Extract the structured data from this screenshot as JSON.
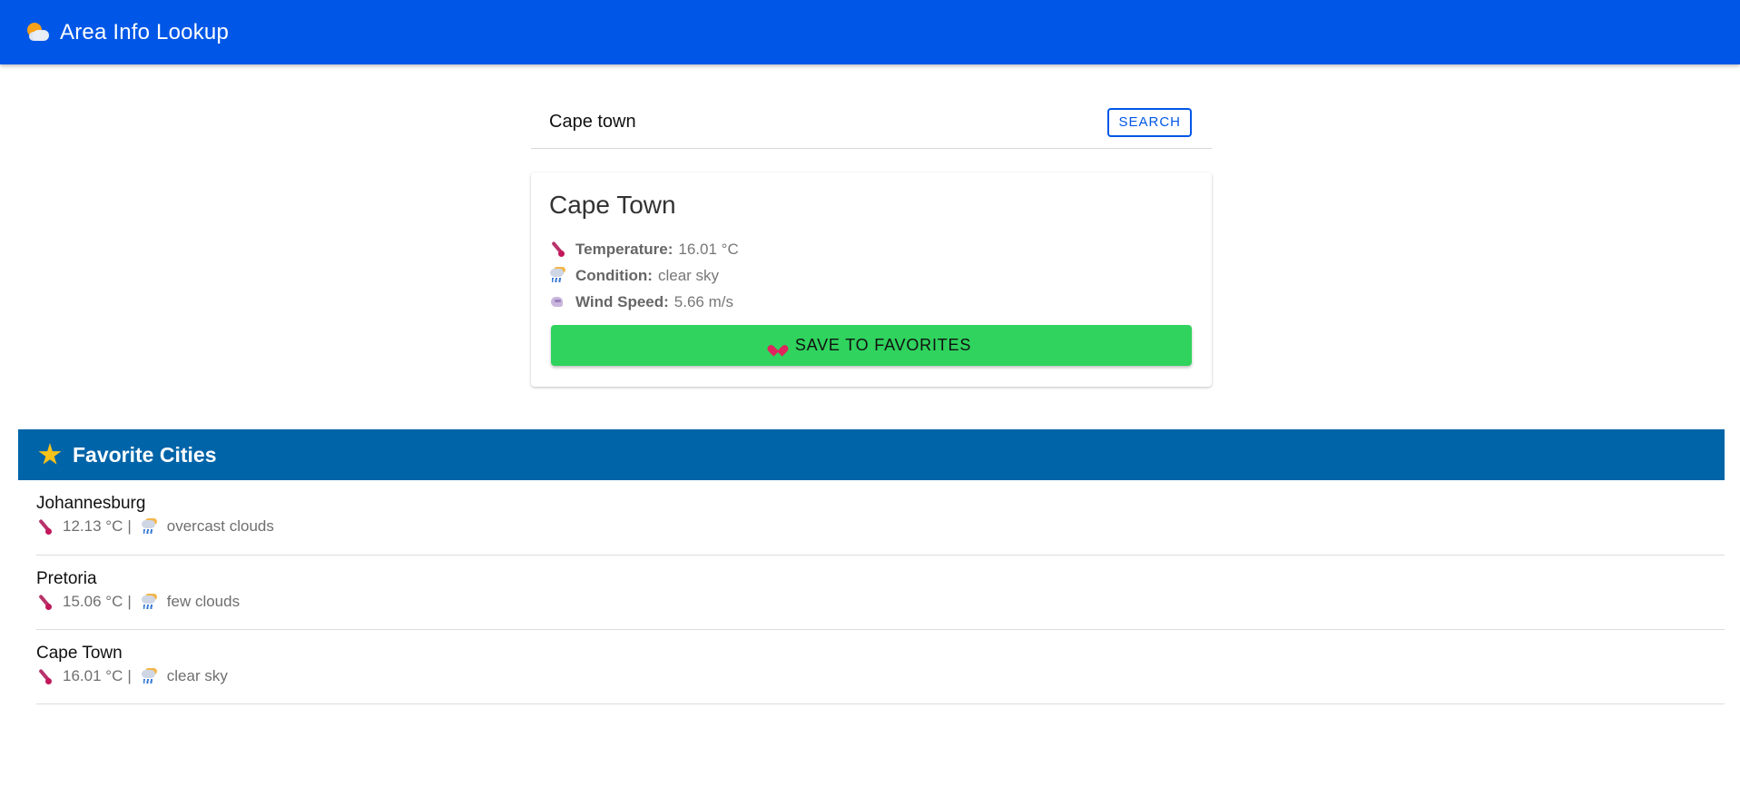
{
  "app": {
    "title": "Area Info Lookup",
    "logo_icon": "sun-behind-cloud-icon",
    "brand_color": "#0057e7"
  },
  "search": {
    "value": "Cape town",
    "placeholder": "",
    "button_label": "SEARCH"
  },
  "result": {
    "city": "Cape Town",
    "temperature_label": "Temperature:",
    "temperature_value": "16.01 °C",
    "condition_label": "Condition:",
    "condition_value": "clear sky",
    "wind_label": "Wind Speed:",
    "wind_value": "5.66 m/s",
    "save_button_label": "SAVE TO FAVORITES",
    "save_button_color": "#2fd35d"
  },
  "favorites": {
    "title": "Favorite Cities",
    "header_color": "#0064a8",
    "separator": "|",
    "items": [
      {
        "name": "Johannesburg",
        "temp": "12.13 °C",
        "condition": "overcast clouds"
      },
      {
        "name": "Pretoria",
        "temp": "15.06 °C",
        "condition": "few clouds"
      },
      {
        "name": "Cape Town",
        "temp": "16.01 °C",
        "condition": "clear sky"
      }
    ]
  }
}
